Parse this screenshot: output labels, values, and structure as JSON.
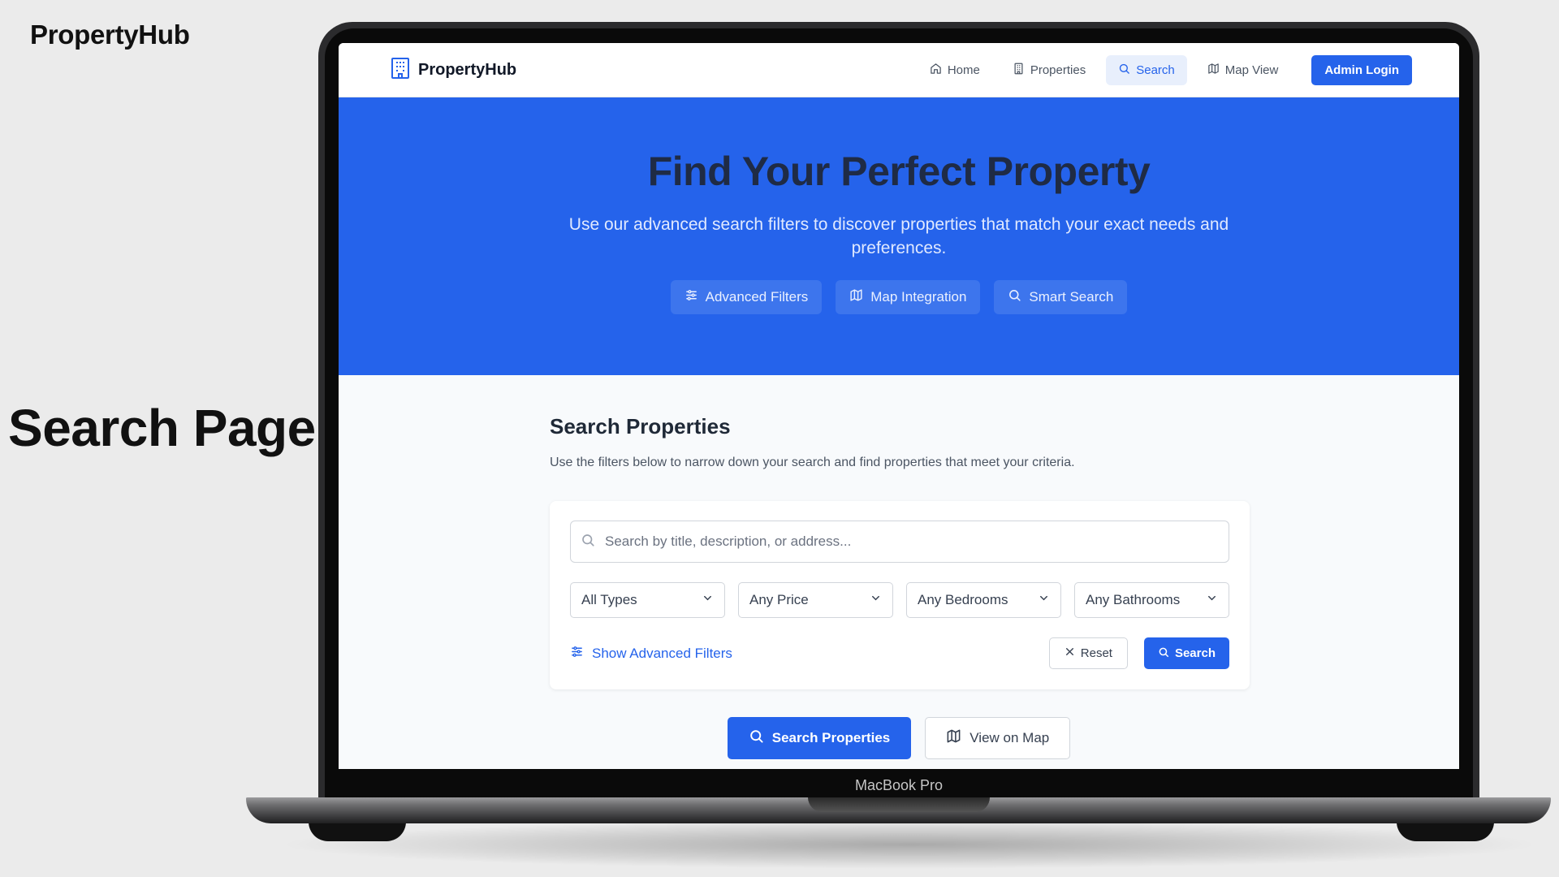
{
  "slide": {
    "brand": "PropertyHub",
    "page_label": "Search Page",
    "device_label": "MacBook Pro"
  },
  "nav": {
    "logo_text": "PropertyHub",
    "items": [
      {
        "label": "Home",
        "icon": "home-icon"
      },
      {
        "label": "Properties",
        "icon": "building-icon"
      },
      {
        "label": "Search",
        "icon": "search-icon",
        "active": true
      },
      {
        "label": "Map View",
        "icon": "map-icon"
      }
    ],
    "admin_label": "Admin Login"
  },
  "hero": {
    "title": "Find Your Perfect Property",
    "subtitle": "Use our advanced search filters to discover properties that match your exact needs and preferences.",
    "chips": [
      {
        "label": "Advanced Filters",
        "icon": "sliders-icon"
      },
      {
        "label": "Map Integration",
        "icon": "map-icon"
      },
      {
        "label": "Smart Search",
        "icon": "search-icon"
      }
    ]
  },
  "search_section": {
    "title": "Search Properties",
    "description": "Use the filters below to narrow down your search and find properties that meet your criteria.",
    "input_placeholder": "Search by title, description, or address...",
    "selects": [
      {
        "value": "All Types"
      },
      {
        "value": "Any Price"
      },
      {
        "value": "Any Bedrooms"
      },
      {
        "value": "Any Bathrooms"
      }
    ],
    "advanced_link": "Show Advanced Filters",
    "reset_label": "Reset",
    "search_label": "Search"
  },
  "bottom_actions": {
    "primary": "Search Properties",
    "secondary": "View on Map"
  },
  "colors": {
    "accent": "#2563eb",
    "page_bg": "#ebebeb",
    "screen_bg": "#f8fafc",
    "hero_title": "#1f2b45"
  }
}
